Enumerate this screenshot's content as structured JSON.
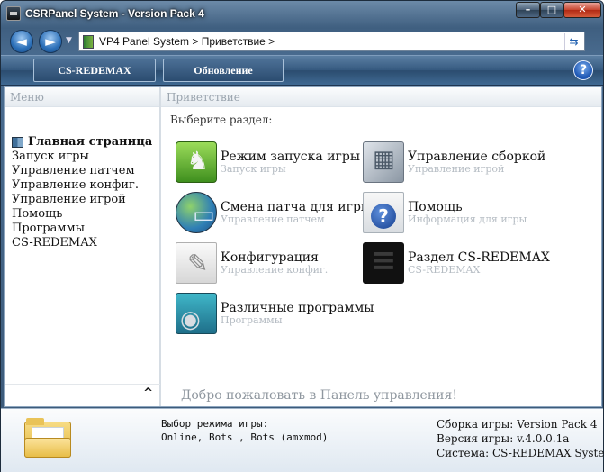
{
  "window": {
    "title": "CSRPanel System - Version Pack 4",
    "btn_min": "–",
    "btn_max": "□",
    "btn_close": "✕"
  },
  "address": {
    "back": "◄",
    "forward": "►",
    "drop": "▼",
    "path": "VP4 Panel System > Приветствие >",
    "refresh": "⇆"
  },
  "toolbar": {
    "btn1": "CS-REDEMAX",
    "btn2": "Обновление",
    "help": "?"
  },
  "left": {
    "header": "Меню",
    "items": [
      "Главная страница",
      "Запуск игры",
      "Управление патчем",
      "Управление конфиг.",
      "Управление игрой",
      "Помощь",
      "Программы",
      "CS-REDEMAX"
    ],
    "collapse": "^"
  },
  "right": {
    "header": "Приветствие",
    "choose": "Выберите раздел:",
    "tiles": [
      {
        "title": "Режим запуска игры",
        "sub": "Запуск игры"
      },
      {
        "title": "Управление сборкой",
        "sub": "Управление игрой"
      },
      {
        "title": "Смена патча для игры",
        "sub": "Управление патчем"
      },
      {
        "title": "Помощь",
        "sub": "Информация для игры"
      },
      {
        "title": "Конфигурация",
        "sub": "Управление конфиг."
      },
      {
        "title": "Раздел CS-REDEMAX",
        "sub": "CS-REDEMAX"
      },
      {
        "title": "Различные программы",
        "sub": "Программы"
      }
    ],
    "welcome": "Добро пожаловать в Панель управления!"
  },
  "status": {
    "mid_line1": "Выбор режима игры:",
    "mid_line2": "Online, Bots , Bots (amxmod)",
    "build": "Сборка игры: Version Pack 4",
    "version": "Версия игры: v.4.0.0.1a",
    "system": "Система:  CS-REDEMAX System"
  }
}
